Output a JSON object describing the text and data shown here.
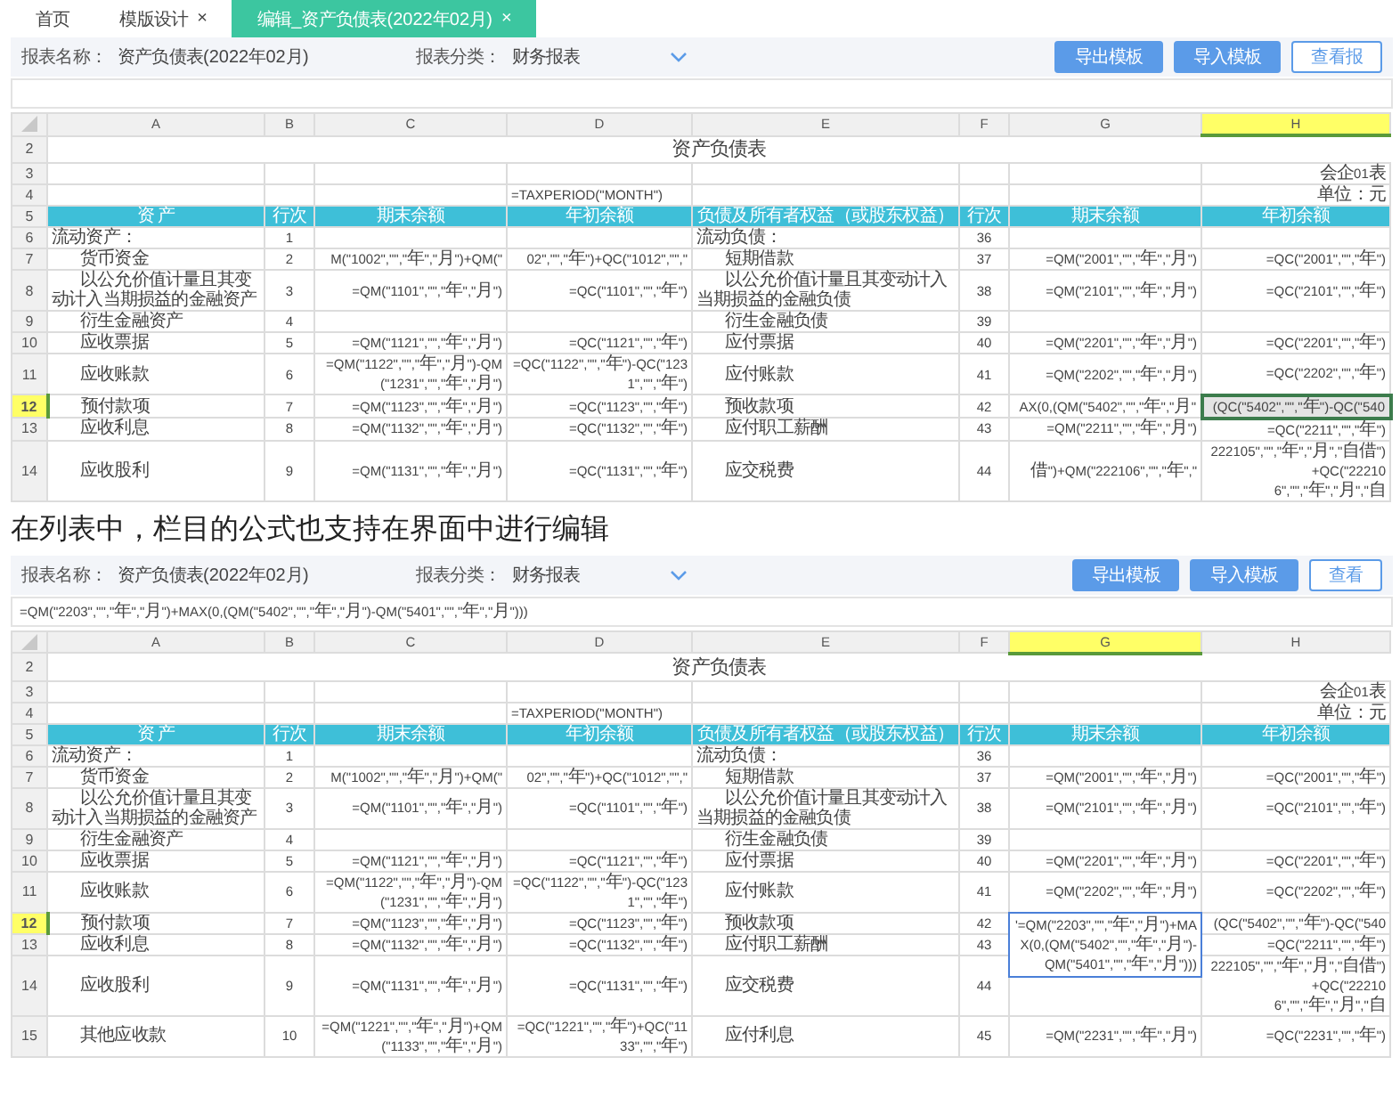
{
  "blocks": [
    {
      "kind": "screenshot",
      "tabs": [
        {
          "label": "首页",
          "selected": false
        },
        {
          "label": "模版设计",
          "selected": false,
          "close": "×"
        },
        {
          "label": "编辑_资产负债表(2022年02月)",
          "selected": true,
          "close": "×"
        }
      ],
      "report_name_label": "报表名称：",
      "report_name": "资产负债表(2022年02月)",
      "category_label": "报表分类：",
      "category": "财务报表",
      "buttons": [
        {
          "label": "导出模板",
          "kind": "primary"
        },
        {
          "label": "导入模板",
          "kind": "primary"
        },
        {
          "label": "查看报",
          "kind": "outline"
        }
      ],
      "columns": [
        {
          "label": "A",
          "selected": false
        },
        {
          "label": "B",
          "selected": false
        },
        {
          "label": "C",
          "selected": false
        },
        {
          "label": "D",
          "selected": false
        },
        {
          "label": "E",
          "selected": false
        },
        {
          "label": "F",
          "selected": false
        },
        {
          "label": "G",
          "selected": false
        },
        {
          "label": "H",
          "selected": true
        }
      ],
      "rows": [
        {
          "number": "2",
          "selected": false,
          "kind": "title",
          "title": "资产负债表"
        },
        {
          "number": "3",
          "selected": false,
          "kind": "info",
          "cells": [
            null,
            null,
            null,
            null,
            null,
            null,
            null,
            "会企01表"
          ]
        },
        {
          "number": "4",
          "selected": false,
          "kind": "info",
          "cells": [
            null,
            null,
            null,
            "=TAXPERIOD(\"MONTH\")",
            null,
            null,
            null,
            "单位：元"
          ]
        },
        {
          "number": "5",
          "selected": false,
          "kind": "header",
          "cells": [
            "资 产",
            "行次",
            "期末余额",
            "年初余额",
            "负债及所有者权益（或股东权益）",
            "行次",
            "期末余额",
            "年初余额"
          ]
        },
        {
          "number": "6",
          "selected": false,
          "kind": "section",
          "cells": [
            "流动资产：",
            "1",
            null,
            null,
            "流动负债：",
            "36",
            null,
            null
          ]
        },
        {
          "number": "7",
          "selected": false,
          "kind": "item",
          "cells": [
            "货币资金",
            "2",
            "M(\"1002\",\"\",\"年\",\"月\")+QM(\"",
            "02\",\"\",\"年\")+QC(\"1012\",\"\",\"",
            "短期借款",
            "37",
            "=QM(\"2001\",\"\",\"年\",\"月\")",
            "=QC(\"2001\",\"\",\"年\")"
          ]
        },
        {
          "number": "8",
          "selected": false,
          "kind": "item",
          "cells": [
            "以公允价值计量且其变动计入当期损益的金融资产",
            "3",
            "=QM(\"1101\",\"\",\"年\",\"月\")",
            "=QC(\"1101\",\"\",\"年\")",
            "以公允价值计量且其变动计入当期损益的金融负债",
            "38",
            "=QM(\"2101\",\"\",\"年\",\"月\")",
            "=QC(\"2101\",\"\",\"年\")"
          ]
        },
        {
          "number": "9",
          "selected": false,
          "kind": "item",
          "cells": [
            "衍生金融资产",
            "4",
            null,
            null,
            "衍生金融负债",
            "39",
            null,
            null
          ]
        },
        {
          "number": "10",
          "selected": false,
          "kind": "item",
          "cells": [
            "应收票据",
            "5",
            "=QM(\"1121\",\"\",\"年\",\"月\")",
            "=QC(\"1121\",\"\",\"年\")",
            "应付票据",
            "40",
            "=QM(\"2201\",\"\",\"年\",\"月\")",
            "=QC(\"2201\",\"\",\"年\")"
          ]
        },
        {
          "number": "11",
          "selected": false,
          "kind": "item",
          "cells": [
            "应收账款",
            "6",
            "=QM(\"1122\",\"\",\"年\",\"月\")-QM(\"1231\",\"\",\"年\",\"月\")",
            "=QC(\"1122\",\"\",\"年\")-QC(\"1231\",\"\",\"年\")",
            "应付账款",
            "41",
            "=QM(\"2202\",\"\",\"年\",\"月\")",
            "=QC(\"2202\",\"\",\"年\")"
          ]
        },
        {
          "number": "12",
          "selected": true,
          "kind": "item",
          "cells": [
            "预付款项",
            "7",
            "=QM(\"1123\",\"\",\"年\",\"月\")",
            "=QC(\"1123\",\"\",\"年\")",
            "预收款项",
            "42",
            "AX(0,(QM(\"5402\",\"\",\"年\",\"月\"",
            "(QC(\"5402\",\"\",\"年\")-QC(\"540"
          ]
        },
        {
          "number": "13",
          "selected": false,
          "kind": "item",
          "cells": [
            "应收利息",
            "8",
            "=QM(\"1132\",\"\",\"年\",\"月\")",
            "=QC(\"1132\",\"\",\"年\")",
            "应付职工薪酬",
            "43",
            "=QM(\"2211\",\"\",\"年\",\"月\")",
            "=QC(\"2211\",\"\",\"年\")"
          ]
        },
        {
          "number": "14",
          "selected": false,
          "kind": "item",
          "cells": [
            "应收股利",
            "9",
            "=QM(\"1131\",\"\",\"年\",\"月\")",
            "=QC(\"1131\",\"\",\"年\")",
            "应交税费",
            "44",
            "借\")+QM(\"222106\",\"\",\"年\",\"",
            "222105\",\"\",\"年\",\"月\",\"自借\")+QC(\"222106\",\"\",\"年\",\"月\",\"自"
          ]
        }
      ]
    },
    {
      "kind": "caption",
      "text": "在列表中，栏目的公式也支持在界面中进行编辑"
    },
    {
      "kind": "screenshot",
      "report_name_label": "报表名称：",
      "report_name": "资产负债表(2022年02月)",
      "category_label": "报表分类：",
      "category": "财务报表",
      "buttons": [
        {
          "label": "导出模板",
          "kind": "primary"
        },
        {
          "label": "导入模板",
          "kind": "primary"
        },
        {
          "label": "查看",
          "kind": "outline"
        }
      ],
      "formula": "=QM(\"2203\",\"\",\"年\",\"月\")+MAX(0,(QM(\"5402\",\"\",\"年\",\"月\")-QM(\"5401\",\"\",\"年\",\"月\")))",
      "columns": [
        {
          "label": "A",
          "selected": false
        },
        {
          "label": "B",
          "selected": false
        },
        {
          "label": "C",
          "selected": false
        },
        {
          "label": "D",
          "selected": false
        },
        {
          "label": "E",
          "selected": false
        },
        {
          "label": "F",
          "selected": false
        },
        {
          "label": "G",
          "selected": true
        },
        {
          "label": "H",
          "selected": false
        }
      ],
      "editor": {
        "text": "'=QM(\"2203\",\"\",\"年\",\"月\")+MAX(0,(QM(\"5402\",\"\",\"年\",\"月\")-QM(\"5401\",\"\",\"年\",\"月\")))"
      },
      "rows": [
        {
          "number": "2",
          "selected": false,
          "kind": "title",
          "title": "资产负债表"
        },
        {
          "number": "3",
          "selected": false,
          "kind": "info",
          "cells": [
            null,
            null,
            null,
            null,
            null,
            null,
            null,
            "会企01表"
          ]
        },
        {
          "number": "4",
          "selected": false,
          "kind": "info",
          "cells": [
            null,
            null,
            null,
            "=TAXPERIOD(\"MONTH\")",
            null,
            null,
            null,
            "单位：元"
          ]
        },
        {
          "number": "5",
          "selected": false,
          "kind": "header",
          "cells": [
            "资 产",
            "行次",
            "期末余额",
            "年初余额",
            "负债及所有者权益（或股东权益）",
            "行次",
            "期末余额",
            "年初余额"
          ]
        },
        {
          "number": "6",
          "selected": false,
          "kind": "section",
          "cells": [
            "流动资产：",
            "1",
            null,
            null,
            "流动负债：",
            "36",
            null,
            null
          ]
        },
        {
          "number": "7",
          "selected": false,
          "kind": "item",
          "cells": [
            "货币资金",
            "2",
            "M(\"1002\",\"\",\"年\",\"月\")+QM(\"",
            "02\",\"\",\"年\")+QC(\"1012\",\"\",\"",
            "短期借款",
            "37",
            "=QM(\"2001\",\"\",\"年\",\"月\")",
            "=QC(\"2001\",\"\",\"年\")"
          ]
        },
        {
          "number": "8",
          "selected": false,
          "kind": "item",
          "cells": [
            "以公允价值计量且其变动计入当期损益的金融资产",
            "3",
            "=QM(\"1101\",\"\",\"年\",\"月\")",
            "=QC(\"1101\",\"\",\"年\")",
            "以公允价值计量且其变动计入当期损益的金融负债",
            "38",
            "=QM(\"2101\",\"\",\"年\",\"月\")",
            "=QC(\"2101\",\"\",\"年\")"
          ]
        },
        {
          "number": "9",
          "selected": false,
          "kind": "item",
          "cells": [
            "衍生金融资产",
            "4",
            null,
            null,
            "衍生金融负债",
            "39",
            null,
            null
          ]
        },
        {
          "number": "10",
          "selected": false,
          "kind": "item",
          "cells": [
            "应收票据",
            "5",
            "=QM(\"1121\",\"\",\"年\",\"月\")",
            "=QC(\"1121\",\"\",\"年\")",
            "应付票据",
            "40",
            "=QM(\"2201\",\"\",\"年\",\"月\")",
            "=QC(\"2201\",\"\",\"年\")"
          ]
        },
        {
          "number": "11",
          "selected": false,
          "kind": "item",
          "cells": [
            "应收账款",
            "6",
            "=QM(\"1122\",\"\",\"年\",\"月\")-QM(\"1231\",\"\",\"年\",\"月\")",
            "=QC(\"1122\",\"\",\"年\")-QC(\"1231\",\"\",\"年\")",
            "应付账款",
            "41",
            "=QM(\"2202\",\"\",\"年\",\"月\")",
            "=QC(\"2202\",\"\",\"年\")"
          ]
        },
        {
          "number": "12",
          "selected": true,
          "kind": "item",
          "cells": [
            "预付款项",
            "7",
            "=QM(\"1123\",\"\",\"年\",\"月\")",
            "=QC(\"1123\",\"\",\"年\")",
            "预收款项",
            "42",
            null,
            "(QC(\"5402\",\"\",\"年\")-QC(\"540"
          ]
        },
        {
          "number": "13",
          "selected": false,
          "kind": "item",
          "cells": [
            "应收利息",
            "8",
            "=QM(\"1132\",\"\",\"年\",\"月\")",
            "=QC(\"1132\",\"\",\"年\")",
            "应付职工薪酬",
            "43",
            null,
            "=QC(\"2211\",\"\",\"年\")"
          ]
        },
        {
          "number": "14",
          "selected": false,
          "kind": "item",
          "cells": [
            "应收股利",
            "9",
            "=QM(\"1131\",\"\",\"年\",\"月\")",
            "=QC(\"1131\",\"\",\"年\")",
            "应交税费",
            "44",
            null,
            "222105\",\"\",\"年\",\"月\",\"自借\")+QC(\"222106\",\"\",\"年\",\"月\",\"自"
          ]
        },
        {
          "number": "15",
          "selected": false,
          "kind": "item",
          "cells": [
            "其他应收款",
            "10",
            "=QM(\"1221\",\"\",\"年\",\"月\")+QM(\"1133\",\"\",\"年\",\"月\")",
            "=QC(\"1221\",\"\",\"年\")+QC(\"1133\",\"\",\"年\")",
            "应付利息",
            "45",
            "=QM(\"2231\",\"\",\"年\",\"月\")",
            "=QC(\"2231\",\"\",\"年\")"
          ]
        }
      ]
    }
  ]
}
